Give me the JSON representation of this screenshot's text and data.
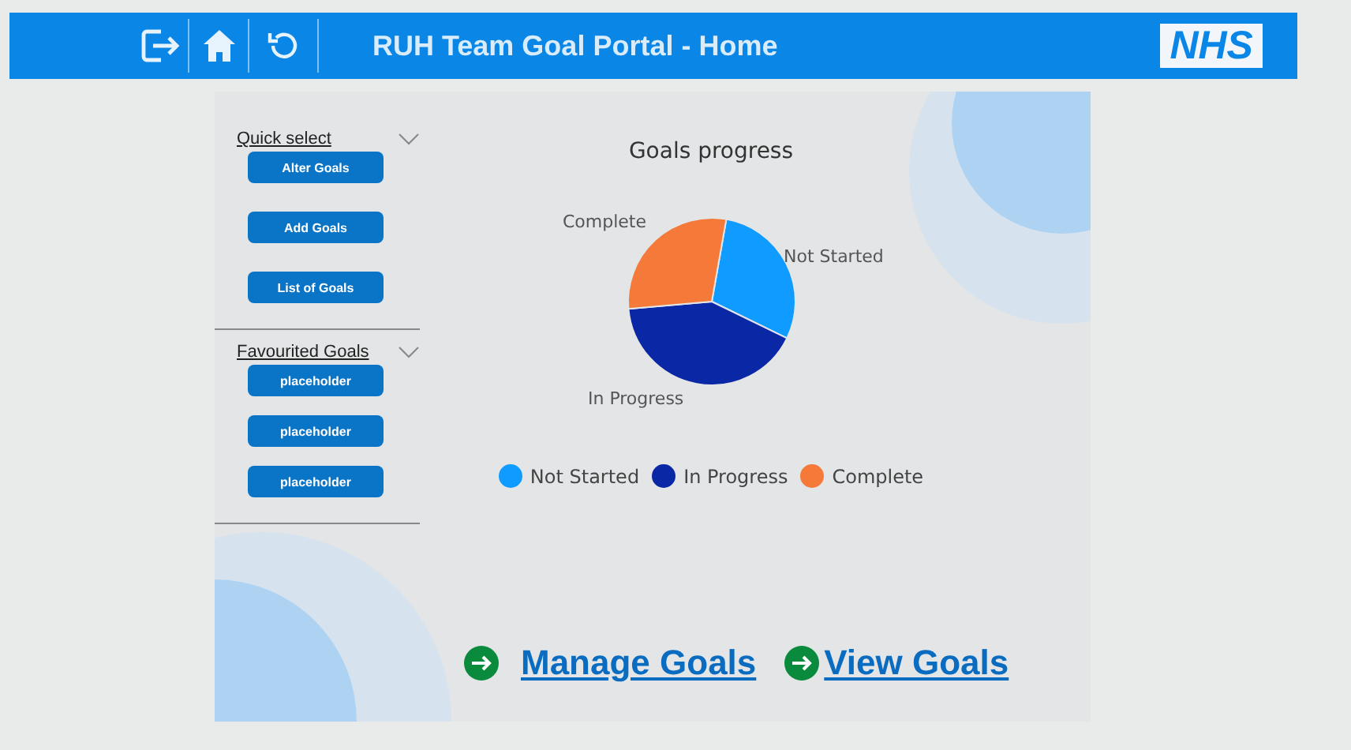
{
  "header": {
    "title": "RUH Team Goal Portal - Home",
    "logo": "NHS"
  },
  "sidebar": {
    "sections": [
      {
        "title": "Quick select",
        "expanded": true,
        "buttons": [
          "Alter Goals",
          "Add Goals",
          "List of Goals"
        ]
      },
      {
        "title": "Favourited Goals",
        "expanded": true,
        "buttons": [
          "placeholder",
          "placeholder",
          "placeholder"
        ]
      }
    ]
  },
  "chart": {
    "title": "Goals progress",
    "slices": [
      {
        "label": "Not Started",
        "color": "#0f9bff"
      },
      {
        "label": "In Progress",
        "color": "#0a27a6"
      },
      {
        "label": "Complete",
        "color": "#f57a3a"
      }
    ],
    "legend": [
      {
        "label": "Not Started",
        "color": "#0f9bff"
      },
      {
        "label": "In Progress",
        "color": "#0a27a6"
      },
      {
        "label": "Complete",
        "color": "#f57a3a"
      }
    ]
  },
  "links": [
    "Manage Goals",
    "View Goals"
  ]
}
